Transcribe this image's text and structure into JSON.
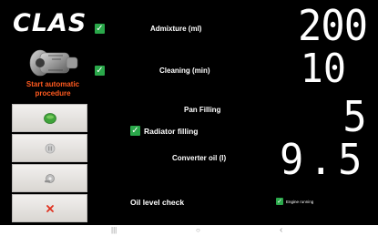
{
  "logo": "CLAS",
  "admixture": {
    "label": "Admixture (ml)",
    "value": "200"
  },
  "cleaning": {
    "label": "Cleaning (min)",
    "value": "10"
  },
  "pan_filling": {
    "label": "Pan Filling",
    "value": "5"
  },
  "radiator": {
    "label": "Radiator filling"
  },
  "converter": {
    "label": "Converter oil (l)",
    "value": "9.5"
  },
  "oil_level": {
    "label": "Oil level check"
  },
  "engine_running": {
    "label": "Engine running"
  },
  "auto": {
    "label_line1": "Start automatic",
    "label_line2": "procedure"
  },
  "colors": {
    "accent_orange": "#ff5a1f",
    "check_green": "#2aa84a",
    "start_green": "#3fa33a",
    "cancel_red": "#e0301e"
  },
  "icons": {
    "start": "green-play-icon",
    "pause": "pause-icon",
    "settings": "tool-icon",
    "cancel": "close-icon"
  },
  "navbar": {
    "recent": "|||",
    "home": "○",
    "back": "‹"
  }
}
